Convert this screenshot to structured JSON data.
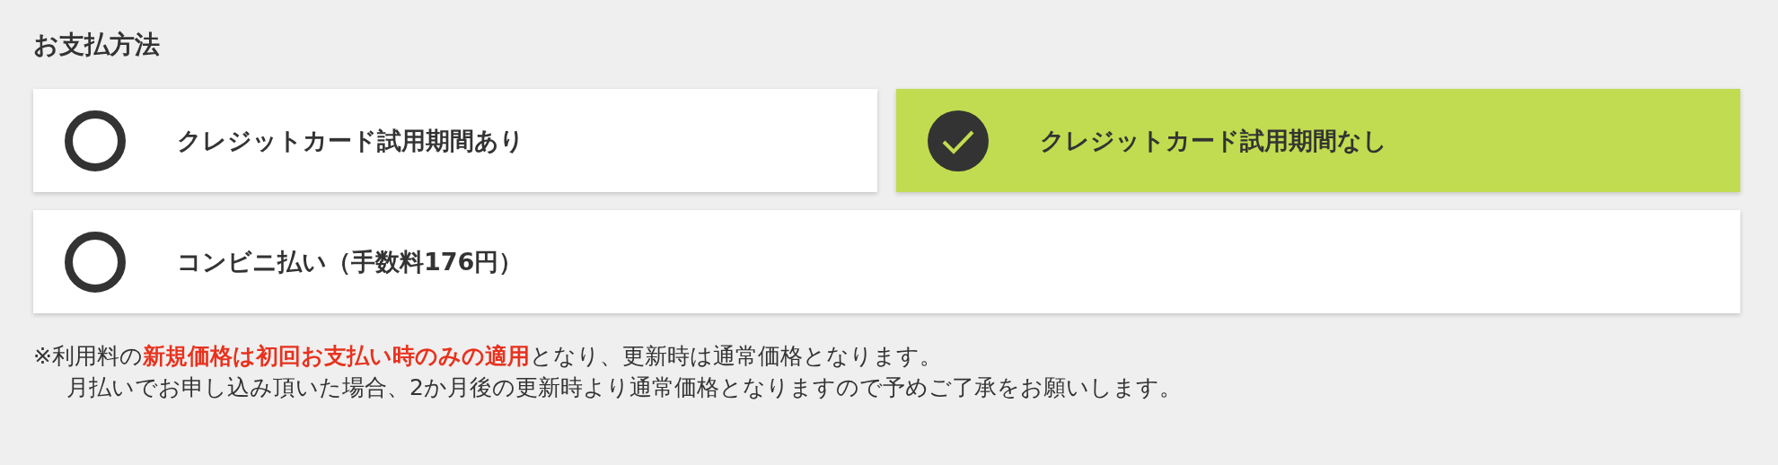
{
  "heading": "お支払方法",
  "options": [
    {
      "label": "クレジットカード試用期間あり",
      "selected": false
    },
    {
      "label": "クレジットカード試用期間なし",
      "selected": true
    },
    {
      "label": "コンビニ払い（手数料176円）",
      "selected": false
    }
  ],
  "note": [
    "※利用料の**新規価格は初回お支払い時のみの適用**となり、更新時は通常価格となります。",
    "月払いでお申し込み頂いた場合、2か月後の更新時より通常価格となりますので予めご了承をお願いします。"
  ]
}
